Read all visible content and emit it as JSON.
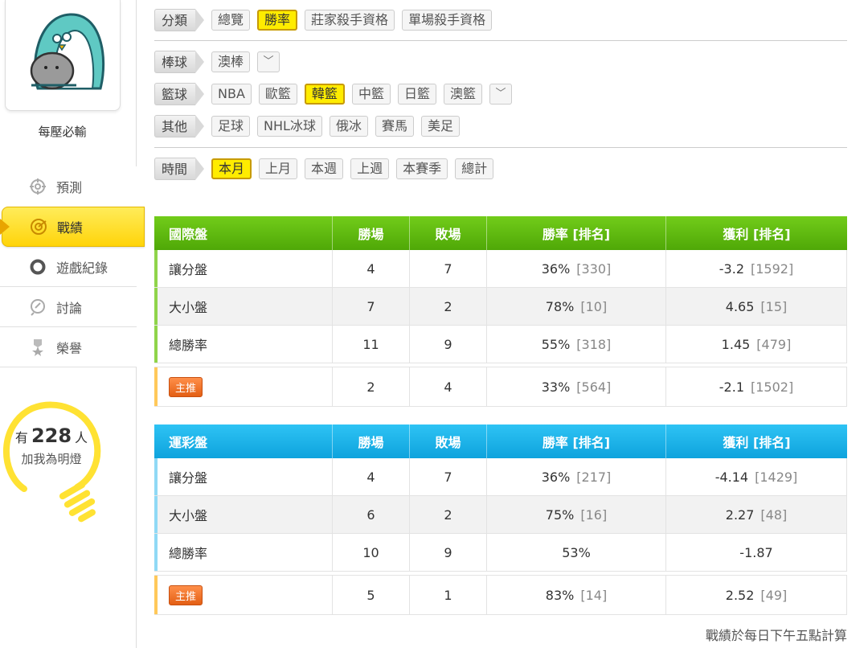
{
  "user": {
    "name": "每壓必輸"
  },
  "menu": [
    {
      "label": "預測",
      "icon": "target-icon"
    },
    {
      "label": "戰績",
      "icon": "record-icon"
    },
    {
      "label": "遊戲紀錄",
      "icon": "circle-icon"
    },
    {
      "label": "討論",
      "icon": "discussion-icon"
    },
    {
      "label": "榮譽",
      "icon": "medal-icon"
    }
  ],
  "fans": {
    "prefix": "有",
    "count": "228",
    "suffix": "人",
    "line2": "加我為明燈"
  },
  "filters": {
    "category": {
      "label": "分類",
      "options": [
        "總覽",
        "勝率",
        "莊家殺手資格",
        "單場殺手資格"
      ],
      "selected": "勝率"
    },
    "baseball": {
      "label": "棒球",
      "options": [
        "澳棒"
      ]
    },
    "basketball": {
      "label": "籃球",
      "options": [
        "NBA",
        "歐籃",
        "韓籃",
        "中籃",
        "日籃",
        "澳籃"
      ],
      "selected": "韓籃"
    },
    "other": {
      "label": "其他",
      "options": [
        "足球",
        "NHL冰球",
        "俄冰",
        "賽馬",
        "美足"
      ]
    },
    "time": {
      "label": "時間",
      "options": [
        "本月",
        "上月",
        "本週",
        "上週",
        "本賽季",
        "總計"
      ],
      "selected": "本月"
    }
  },
  "tables": [
    {
      "title": "國際盤",
      "headers": [
        "勝場",
        "敗場",
        "勝率 [排名]",
        "獲利 [排名]"
      ],
      "rows": [
        {
          "name": "讓分盤",
          "win": "4",
          "lose": "7",
          "rate": "36%",
          "rate_rank": "[330]",
          "profit": "-3.2",
          "profit_rank": "[1592]"
        },
        {
          "name": "大小盤",
          "win": "7",
          "lose": "2",
          "rate": "78%",
          "rate_rank": "[10]",
          "profit": "4.65",
          "profit_rank": "[15]"
        },
        {
          "name": "總勝率",
          "win": "11",
          "lose": "9",
          "rate": "55%",
          "rate_rank": "[318]",
          "profit": "1.45",
          "profit_rank": "[479]"
        }
      ],
      "main": {
        "badge": "主推",
        "win": "2",
        "lose": "4",
        "rate": "33%",
        "rate_rank": "[564]",
        "profit": "-2.1",
        "profit_rank": "[1502]"
      }
    },
    {
      "title": "運彩盤",
      "headers": [
        "勝場",
        "敗場",
        "勝率 [排名]",
        "獲利 [排名]"
      ],
      "rows": [
        {
          "name": "讓分盤",
          "win": "4",
          "lose": "7",
          "rate": "36%",
          "rate_rank": "[217]",
          "profit": "-4.14",
          "profit_rank": "[1429]"
        },
        {
          "name": "大小盤",
          "win": "6",
          "lose": "2",
          "rate": "75%",
          "rate_rank": "[16]",
          "profit": "2.27",
          "profit_rank": "[48]"
        },
        {
          "name": "總勝率",
          "win": "10",
          "lose": "9",
          "rate": "53%",
          "rate_rank": "",
          "profit": "-1.87",
          "profit_rank": ""
        }
      ],
      "main": {
        "badge": "主推",
        "win": "5",
        "lose": "1",
        "rate": "83%",
        "rate_rank": "[14]",
        "profit": "2.52",
        "profit_rank": "[49]"
      }
    }
  ],
  "footnote": "戰績於每日下午五點計算",
  "colors": {
    "active_yellow": "#ffec00",
    "green_header": "#5cb80e",
    "blue_header": "#16aee6",
    "badge_orange": "#f07020"
  }
}
